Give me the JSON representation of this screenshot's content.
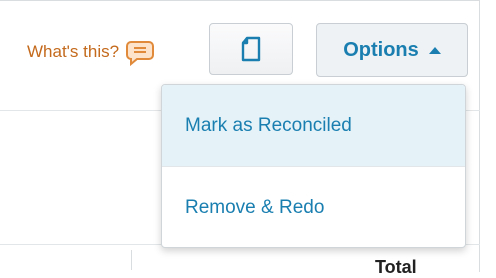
{
  "header": {
    "help_link": "What's this?",
    "help_icon": "speech-bubble-icon",
    "icon_button_icon": "page-icon",
    "options_label": "Options",
    "options_caret_icon": "caret-up-icon"
  },
  "menu": {
    "items": [
      {
        "label": "Mark as Reconciled",
        "active": true
      },
      {
        "label": "Remove & Redo",
        "active": false
      }
    ]
  },
  "table": {
    "total_header": "Total"
  },
  "colors": {
    "link_orange": "#c46a1d",
    "accent_blue": "#1a7fb0",
    "menu_hover": "#e5f3f9"
  }
}
